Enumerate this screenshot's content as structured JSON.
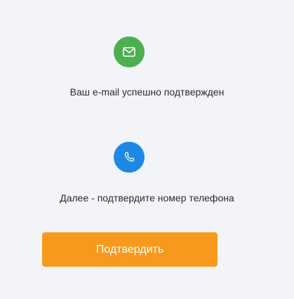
{
  "email_step": {
    "icon": "envelope-icon",
    "icon_color": "#4caf50",
    "message": "Ваш e-mail успешно подтвержден"
  },
  "phone_step": {
    "icon": "phone-icon",
    "icon_color": "#1e88e5",
    "message": "Далее - подтвердите номер телефона"
  },
  "actions": {
    "confirm_label": "Подтвердить",
    "confirm_color": "#f7991c"
  },
  "page": {
    "background": "#f3f4f8"
  }
}
